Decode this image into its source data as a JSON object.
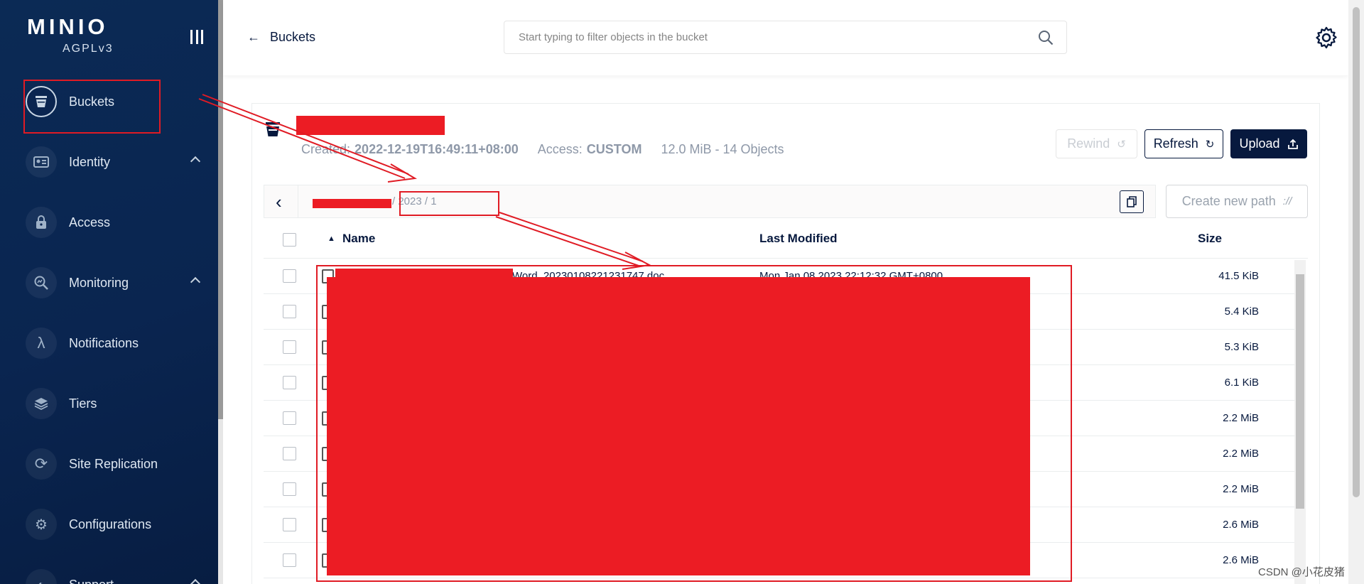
{
  "app": {
    "logo": "MINIO",
    "license": "AGPLv3"
  },
  "sidebar": {
    "items": [
      {
        "label": "Buckets",
        "icon": "bucket-icon",
        "active": true
      },
      {
        "label": "Identity",
        "icon": "id-card-icon",
        "expandable": true
      },
      {
        "label": "Access",
        "icon": "lock-icon"
      },
      {
        "label": "Monitoring",
        "icon": "magnifier-chart-icon",
        "expandable": true
      },
      {
        "label": "Notifications",
        "icon": "lambda-icon"
      },
      {
        "label": "Tiers",
        "icon": "layers-icon"
      },
      {
        "label": "Site Replication",
        "icon": "sync-icon"
      },
      {
        "label": "Configurations",
        "icon": "gear-icon"
      },
      {
        "label": "Support",
        "icon": "support-icon",
        "expandable": true
      }
    ]
  },
  "header": {
    "back_label": "Buckets",
    "search_placeholder": "Start typing to filter objects in the bucket"
  },
  "bucket": {
    "created_label": "Created:",
    "created_value": "2022-12-19T16:49:11+08:00",
    "access_label": "Access:",
    "access_value": "CUSTOM",
    "summary": "12.0 MiB - 14 Objects"
  },
  "actions": {
    "rewind": "Rewind",
    "refresh": "Refresh",
    "upload": "Upload",
    "create_path": "Create new path"
  },
  "breadcrumb": {
    "path": "/ 2023 / 1"
  },
  "table": {
    "columns": {
      "name": "Name",
      "modified": "Last Modified",
      "size": "Size"
    },
    "rows": [
      {
        "name": "Word_20230108221231747.doc",
        "modified": "Mon Jan 08 2023 22:12:32 GMT+0800",
        "size": "41.5 KiB"
      },
      {
        "name": "",
        "modified": "",
        "size": "5.4 KiB"
      },
      {
        "name": "",
        "modified": "",
        "size": "5.3 KiB"
      },
      {
        "name": "",
        "modified": "",
        "size": "6.1 KiB"
      },
      {
        "name": "",
        "modified": "",
        "size": "2.2 MiB"
      },
      {
        "name": "",
        "modified": "",
        "size": "2.2 MiB"
      },
      {
        "name": "",
        "modified": "",
        "size": "2.2 MiB"
      },
      {
        "name": "",
        "modified": "",
        "size": "2.6 MiB"
      },
      {
        "name": "",
        "modified": "",
        "size": "2.6 MiB"
      }
    ]
  },
  "watermark": "CSDN @小花皮猪",
  "colors": {
    "navy": "#07193e",
    "annotation_red": "#e01b24",
    "redaction": "#ec1c24"
  }
}
